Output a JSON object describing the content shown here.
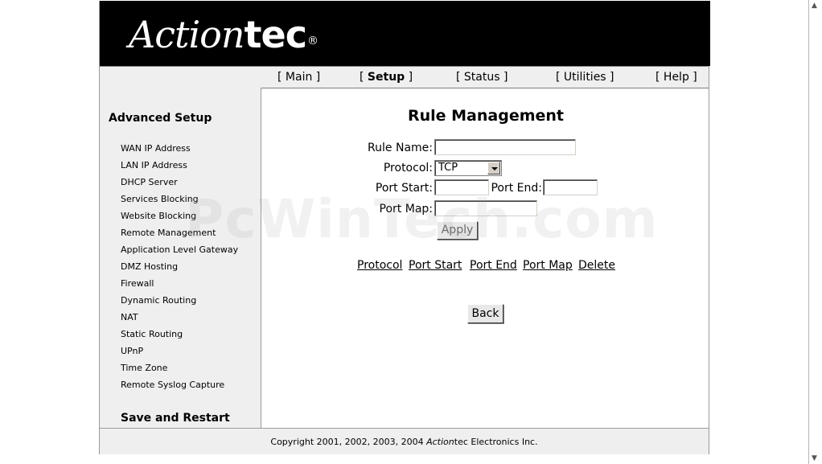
{
  "logo": {
    "script": "Action",
    "bold": "tec",
    "mark": "®"
  },
  "nav": {
    "main": "[ Main ]",
    "setup_open": "[ ",
    "setup": "Setup",
    "setup_close": " ]",
    "status": "[ Status ]",
    "utilities": "[ Utilities ]",
    "help": "[ Help ]"
  },
  "sidebar": {
    "title": "Advanced Setup",
    "items": [
      "WAN IP Address",
      "LAN IP Address",
      "DHCP Server",
      "Services Blocking",
      "Website Blocking",
      "Remote Management",
      "Application Level Gateway",
      "DMZ Hosting",
      "Firewall",
      "Dynamic Routing",
      "NAT",
      "Static Routing",
      "UPnP",
      "Time Zone",
      "Remote Syslog Capture"
    ],
    "save": "Save and Restart"
  },
  "main": {
    "title": "Rule Management",
    "rule_name_label": "Rule Name:",
    "rule_name_value": "",
    "protocol_label": "Protocol:",
    "protocol_value": "TCP",
    "port_start_label": "Port Start:",
    "port_start_value": "",
    "port_end_label": "Port End:",
    "port_end_value": "",
    "port_map_label": "Port Map:",
    "port_map_value": "",
    "apply": "Apply",
    "columns": [
      "Protocol",
      "Port Start",
      "Port End",
      "Port Map",
      "Delete"
    ],
    "back": "Back"
  },
  "footer": {
    "prefix": "Copyright 2001, 2002, 2003, 2004 ",
    "brand_italic": "Action",
    "suffix": "tec Electronics Inc."
  },
  "watermark": "PcWinTech.com",
  "colors": {
    "header_bg": "#000000",
    "panel_bg": "#efefef",
    "border": "#9a9a9a"
  }
}
